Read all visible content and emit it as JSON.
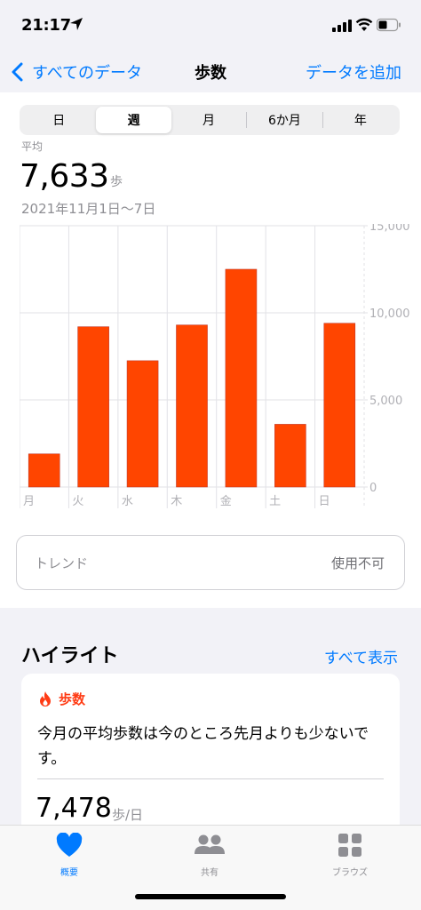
{
  "status_bar": {
    "time": "21:17"
  },
  "nav": {
    "back_label": "すべてのデータ",
    "title": "歩数",
    "add_label": "データを追加"
  },
  "segments": [
    "日",
    "週",
    "月",
    "6か月",
    "年"
  ],
  "active_segment": "週",
  "summary": {
    "label": "平均",
    "value": "7,633",
    "unit": "歩",
    "date_range": "2021年11月1日〜7日"
  },
  "chart_data": {
    "type": "bar",
    "categories": [
      "月",
      "火",
      "水",
      "木",
      "金",
      "土",
      "日"
    ],
    "values": [
      1900,
      9200,
      7250,
      9300,
      12500,
      3600,
      9400
    ],
    "ylim": [
      0,
      15000
    ],
    "yticks": [
      "15,000",
      "10,000",
      "5,000",
      "0"
    ],
    "ytick_values": [
      15000,
      10000,
      5000,
      0
    ],
    "bar_color": "#ff4500",
    "grid": true
  },
  "trend": {
    "label": "トレンド",
    "value": "使用不可"
  },
  "highlights": {
    "title": "ハイライト",
    "show_all": "すべて表示",
    "card": {
      "category": "歩数",
      "message": "今月の平均歩数は今のところ先月よりも少ないです。",
      "value": "7,478",
      "unit": "歩/日"
    }
  },
  "tabbar": {
    "items": [
      {
        "label": "概要",
        "icon": "heart-icon"
      },
      {
        "label": "共有",
        "icon": "people-icon"
      },
      {
        "label": "ブラウズ",
        "icon": "grid-icon"
      }
    ]
  },
  "colors": {
    "accent": "#007aff",
    "bar": "#ff4500",
    "highlight": "#ff3b14"
  }
}
